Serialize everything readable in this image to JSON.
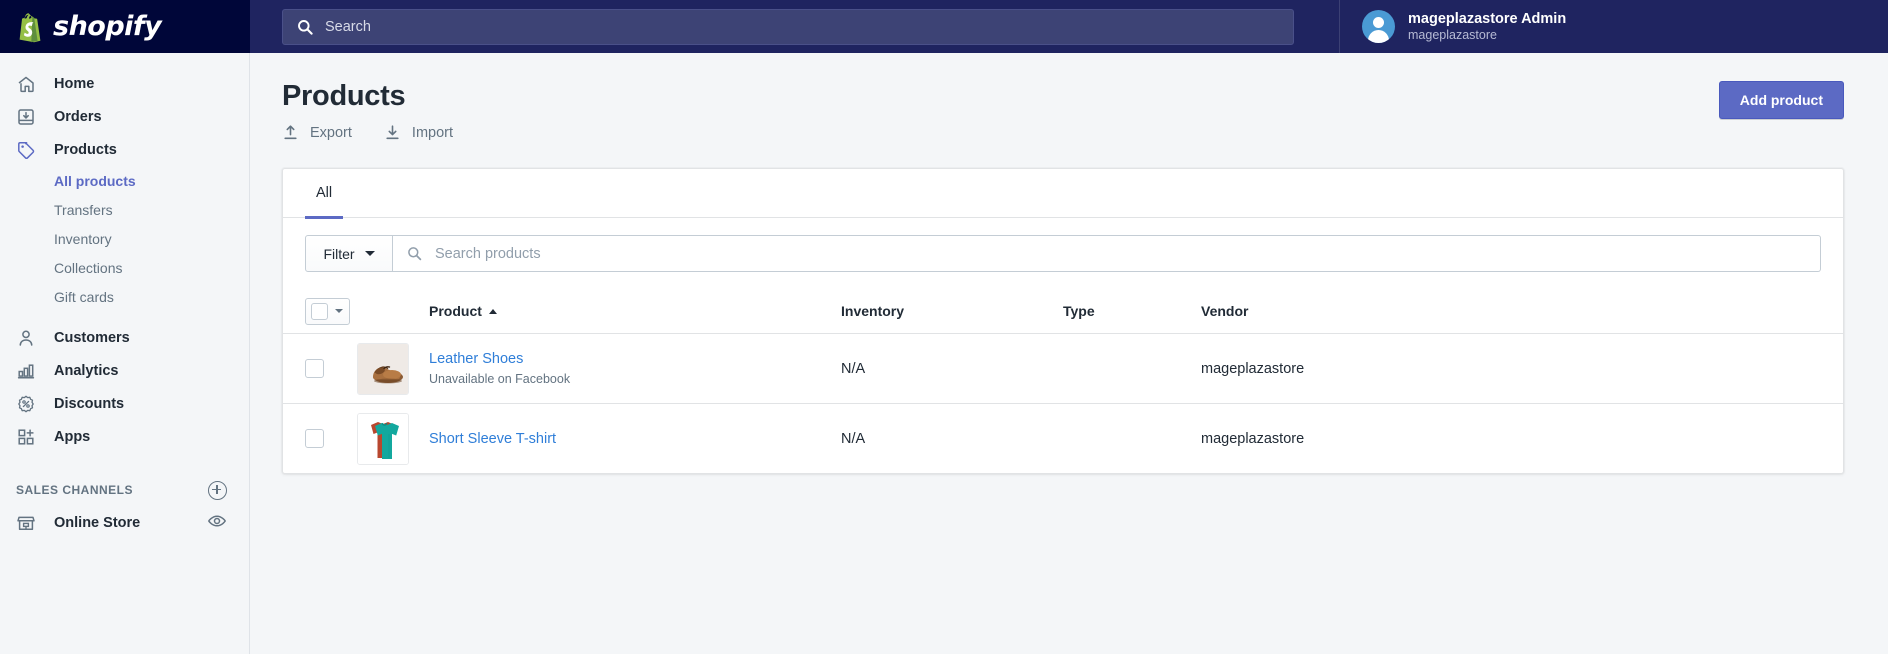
{
  "topbar": {
    "brand_name": "shopify",
    "search": {
      "placeholder": "Search",
      "icon": "search-icon"
    },
    "user": {
      "name": "mageplazastore Admin",
      "store": "mageplazastore",
      "avatar_icon": "user-avatar-icon"
    }
  },
  "sidebar": {
    "items": [
      {
        "label": "Home",
        "icon": "home-icon",
        "active": false
      },
      {
        "label": "Orders",
        "icon": "orders-inbox-icon",
        "active": false
      },
      {
        "label": "Products",
        "icon": "products-tag-icon",
        "active": true
      }
    ],
    "product_subitems": [
      {
        "label": "All products",
        "active": true
      },
      {
        "label": "Transfers",
        "active": false
      },
      {
        "label": "Inventory",
        "active": false
      },
      {
        "label": "Collections",
        "active": false
      },
      {
        "label": "Gift cards",
        "active": false
      }
    ],
    "items_lower": [
      {
        "label": "Customers",
        "icon": "customers-person-icon"
      },
      {
        "label": "Analytics",
        "icon": "analytics-bars-icon"
      },
      {
        "label": "Discounts",
        "icon": "discounts-percent-badge-icon"
      },
      {
        "label": "Apps",
        "icon": "apps-grid-plus-icon"
      }
    ],
    "sales_channels": {
      "title": "SALES CHANNELS",
      "add_icon": "plus-circle-icon",
      "channels": [
        {
          "label": "Online Store",
          "icon": "storefront-icon",
          "action_icon": "eye-icon"
        }
      ]
    }
  },
  "page": {
    "title": "Products",
    "actions": [
      {
        "label": "Export",
        "icon": "export-up-arrow-icon"
      },
      {
        "label": "Import",
        "icon": "import-down-arrow-icon"
      }
    ],
    "primary_button": {
      "label": "Add product",
      "color": "#5c6ac4"
    }
  },
  "card": {
    "tabs": [
      {
        "label": "All",
        "active": true
      }
    ],
    "filter": {
      "label": "Filter",
      "caret_icon": "chevron-down-icon"
    },
    "search": {
      "placeholder": "Search products",
      "icon": "search-icon"
    },
    "table": {
      "columns": [
        "Product",
        "Inventory",
        "Type",
        "Vendor"
      ],
      "sort_column": "Product",
      "sort_direction": "asc",
      "rows": [
        {
          "name": "Leather Shoes",
          "subtitle": "Unavailable on Facebook",
          "inventory": "N/A",
          "type": "",
          "vendor": "mageplazastore",
          "thumb": "leather-shoes-thumbnail"
        },
        {
          "name": "Short Sleeve T-shirt",
          "subtitle": "",
          "inventory": "N/A",
          "type": "",
          "vendor": "mageplazastore",
          "thumb": "tshirt-thumbnail"
        }
      ]
    }
  }
}
